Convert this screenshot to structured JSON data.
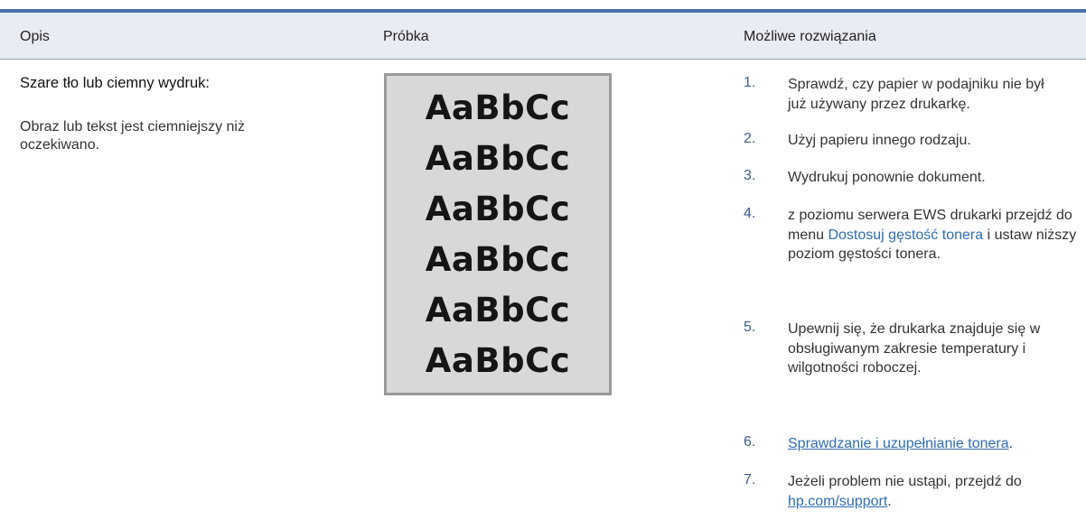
{
  "header": {
    "col1": "Opis",
    "col2": "Próbka",
    "col3": "Możliwe rozwiązania"
  },
  "description": {
    "title": "Szare tło lub ciemny wydruk:",
    "text": "Obraz lub tekst jest ciemniejszy niż oczekiwano."
  },
  "sample": {
    "lines": [
      "AaBbCc",
      "AaBbCc",
      "AaBbCc",
      "AaBbCc",
      "AaBbCc",
      "AaBbCc"
    ]
  },
  "solutions": [
    {
      "num": "1.",
      "text": "Sprawdź, czy papier w podajniku nie był już używany przez drukarkę."
    },
    {
      "num": "2.",
      "text": "Użyj papieru innego rodzaju."
    },
    {
      "num": "3.",
      "text": "Wydrukuj ponownie dokument."
    },
    {
      "num": "4.",
      "pre": "z poziomu serwera EWS drukarki przejdź do menu ",
      "link": "Dostosuj gęstość tonera",
      "post": " i ustaw niższy poziom gęstości tonera."
    },
    {
      "num": "5.",
      "text": "Upewnij się, że drukarka znajduje się w obsługiwanym zakresie temperatury i wilgotności roboczej."
    },
    {
      "num": "6.",
      "link": "Sprawdzanie i uzupełnianie tonera",
      "post": "."
    },
    {
      "num": "7.",
      "pre": "Jeżeli problem nie ustąpi, przejdź do ",
      "link": "hp.com/support",
      "post": "."
    }
  ]
}
